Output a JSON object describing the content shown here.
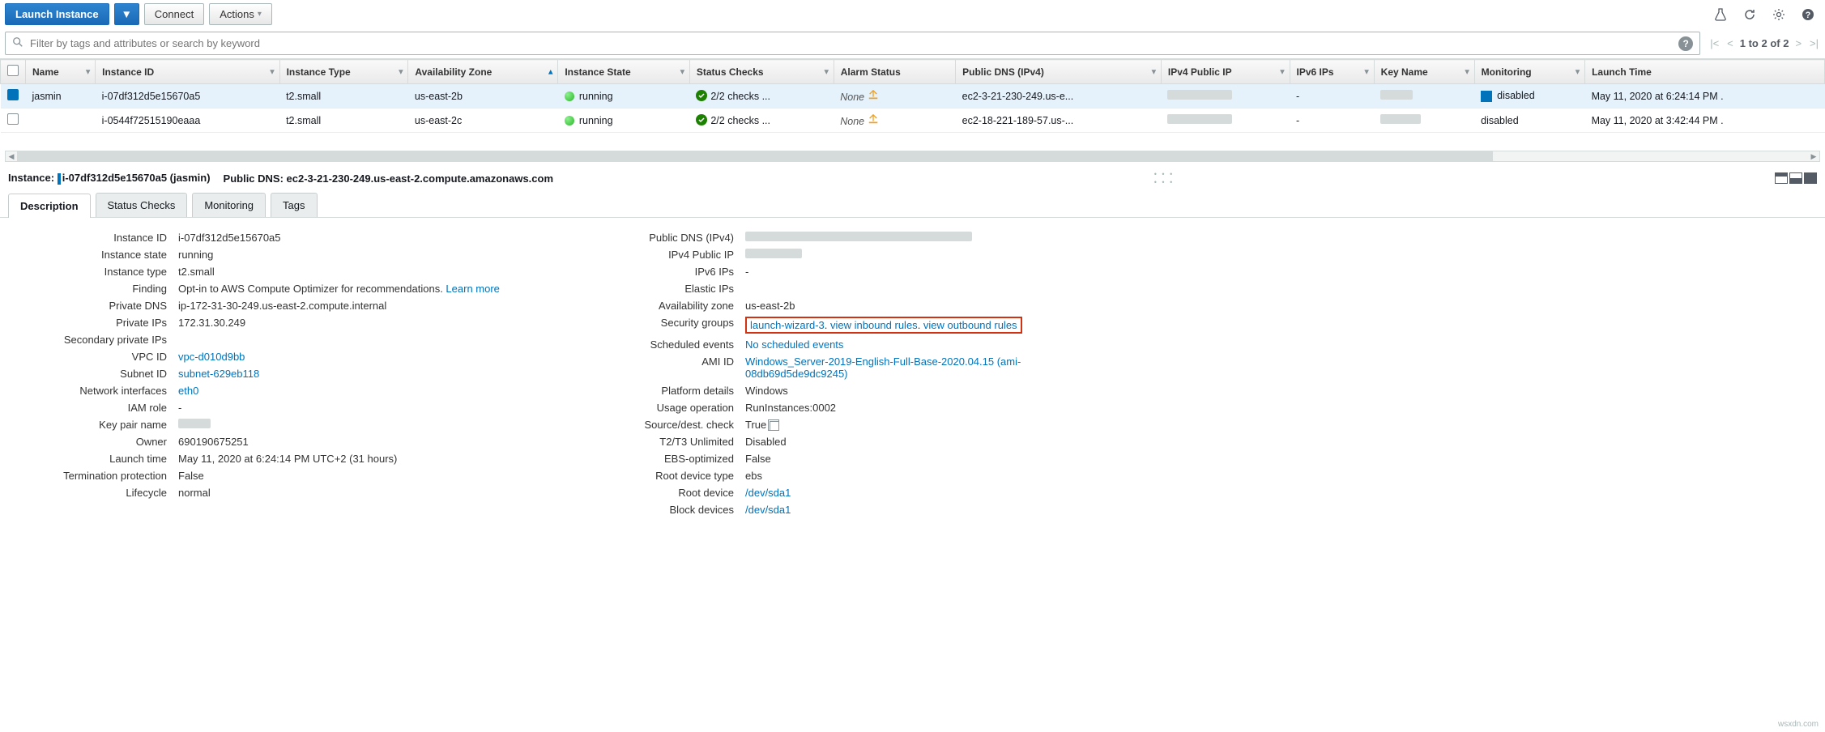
{
  "toolbar": {
    "launch": "Launch Instance",
    "connect": "Connect",
    "actions": "Actions"
  },
  "search": {
    "placeholder": "Filter by tags and attributes or search by keyword"
  },
  "pager": {
    "text": "1 to 2 of 2"
  },
  "columns": [
    "",
    "Name",
    "Instance ID",
    "Instance Type",
    "Availability Zone",
    "Instance State",
    "Status Checks",
    "Alarm Status",
    "Public DNS (IPv4)",
    "IPv4 Public IP",
    "IPv6 IPs",
    "Key Name",
    "Monitoring",
    "Launch Time"
  ],
  "rows": [
    {
      "selected": true,
      "name": "jasmin",
      "instance_id": "i-07df312d5e15670a5",
      "type": "t2.small",
      "az": "us-east-2b",
      "state": "running",
      "checks": "2/2 checks ...",
      "alarm": "None",
      "dns": "ec2-3-21-230-249.us-e...",
      "ipv4": "",
      "ipv6": "-",
      "key": "",
      "monitoring": "disabled",
      "launch": "May 11, 2020 at 6:24:14 PM ."
    },
    {
      "selected": false,
      "name": "",
      "instance_id": "i-0544f72515190eaaa",
      "type": "t2.small",
      "az": "us-east-2c",
      "state": "running",
      "checks": "2/2 checks ...",
      "alarm": "None",
      "dns": "ec2-18-221-189-57.us-...",
      "ipv4": "",
      "ipv6": "-",
      "key": "",
      "monitoring": "disabled",
      "launch": "May 11, 2020 at 3:42:44 PM ."
    }
  ],
  "detail": {
    "instance_label": "Instance:",
    "instance_value": "i-07df312d5e15670a5 (jasmin)",
    "dns_label": "Public DNS: ec2-3-21-230-249.us-east-2.compute.amazonaws.com"
  },
  "tabs": [
    "Description",
    "Status Checks",
    "Monitoring",
    "Tags"
  ],
  "left": {
    "instance_id_k": "Instance ID",
    "instance_id_v": "i-07df312d5e15670a5",
    "state_k": "Instance state",
    "state_v": "running",
    "type_k": "Instance type",
    "type_v": "t2.small",
    "finding_k": "Finding",
    "finding_v": "Opt-in to AWS Compute Optimizer for recommendations. ",
    "finding_link": "Learn more",
    "pdns_k": "Private DNS",
    "pdns_v": "ip-172-31-30-249.us-east-2.compute.internal",
    "pips_k": "Private IPs",
    "pips_v": "172.31.30.249",
    "spips_k": "Secondary private IPs",
    "spips_v": "",
    "vpc_k": "VPC ID",
    "vpc_v": "vpc-d010d9bb",
    "subnet_k": "Subnet ID",
    "subnet_v": "subnet-629eb118",
    "ni_k": "Network interfaces",
    "ni_v": "eth0",
    "iam_k": "IAM role",
    "iam_v": "-",
    "keypair_k": "Key pair name",
    "keypair_v": "",
    "owner_k": "Owner",
    "owner_v": "690190675251",
    "ltime_k": "Launch time",
    "ltime_v": "May 11, 2020 at 6:24:14 PM UTC+2 (31 hours)",
    "tp_k": "Termination protection",
    "tp_v": "False",
    "lc_k": "Lifecycle",
    "lc_v": "normal"
  },
  "right": {
    "pdns_k": "Public DNS (IPv4)",
    "pdns_v": "",
    "pip_k": "IPv4 Public IP",
    "pip_v": "",
    "ipv6_k": "IPv6 IPs",
    "ipv6_v": "-",
    "eip_k": "Elastic IPs",
    "eip_v": "",
    "az_k": "Availability zone",
    "az_v": "us-east-2b",
    "sg_k": "Security groups",
    "sg_link1": "launch-wizard-3",
    "sg_link2": "view inbound rules",
    "sg_link3": "view outbound rules",
    "se_k": "Scheduled events",
    "se_v": "No scheduled events",
    "ami_k": "AMI ID",
    "ami_v": "Windows_Server-2019-English-Full-Base-2020.04.15 (ami-08db69d5de9dc9245)",
    "pd_k": "Platform details",
    "pd_v": "Windows",
    "uo_k": "Usage operation",
    "uo_v": "RunInstances:0002",
    "sdc_k": "Source/dest. check",
    "sdc_v": "True",
    "t2_k": "T2/T3 Unlimited",
    "t2_v": "Disabled",
    "ebs_k": "EBS-optimized",
    "ebs_v": "False",
    "rdt_k": "Root device type",
    "rdt_v": "ebs",
    "rd_k": "Root device",
    "rd_v": "/dev/sda1",
    "bd_k": "Block devices",
    "bd_v": "/dev/sda1"
  },
  "watermark": "wsxdn.com"
}
